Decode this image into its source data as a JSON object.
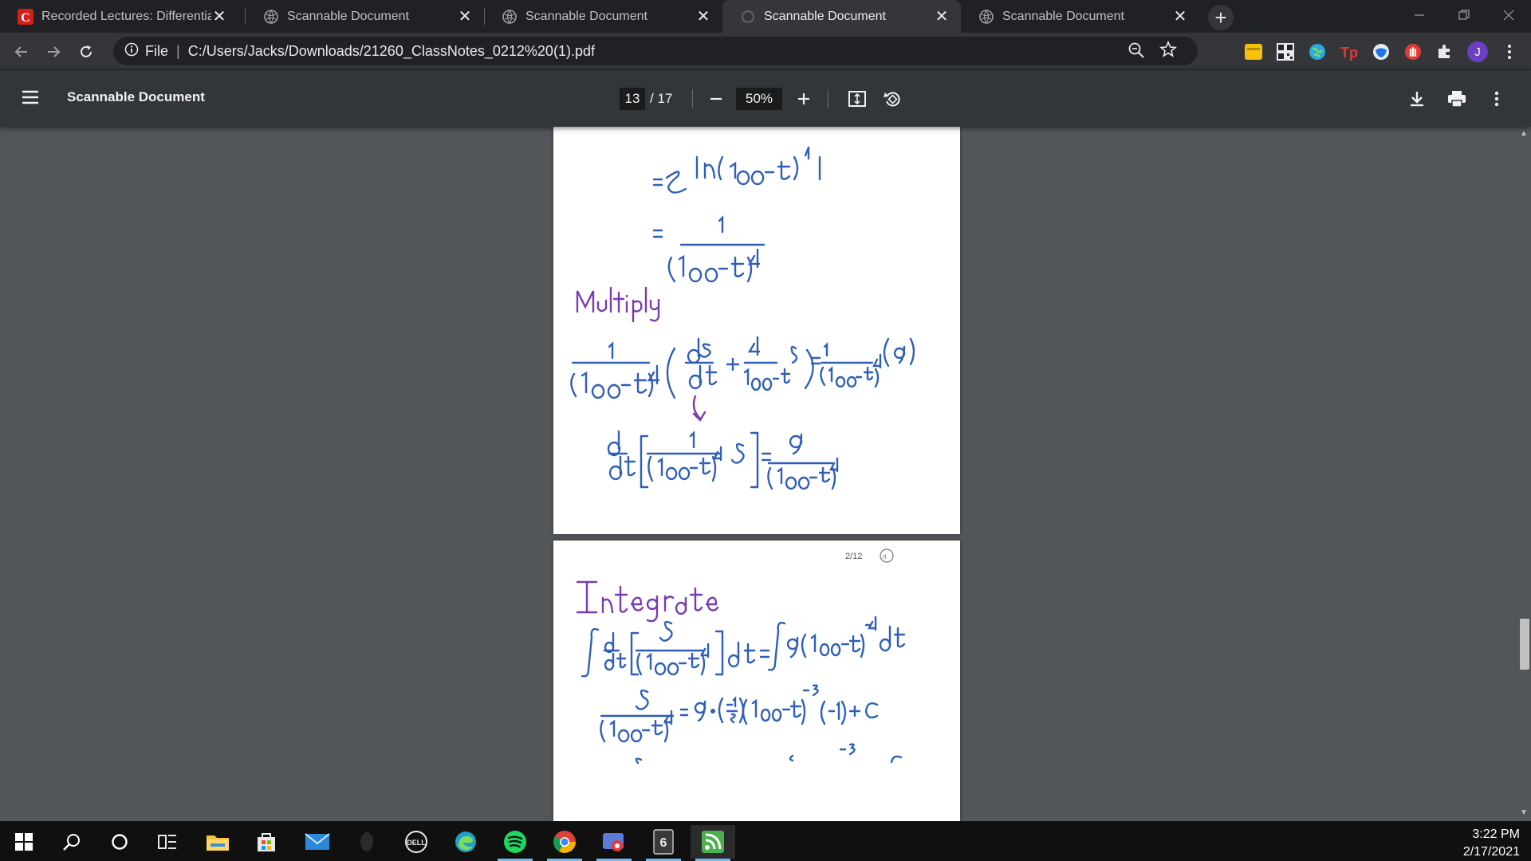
{
  "browser": {
    "tabs": [
      {
        "title": "Recorded Lectures: Differential Eq",
        "active": false,
        "favicon": "canvas-c-icon"
      },
      {
        "title": "Scannable Document",
        "active": false,
        "favicon": "globe-icon"
      },
      {
        "title": "Scannable Document",
        "active": false,
        "favicon": "globe-icon"
      },
      {
        "title": "Scannable Document",
        "active": true,
        "favicon": "loading-icon"
      },
      {
        "title": "Scannable Document",
        "active": false,
        "favicon": "globe-icon"
      }
    ],
    "close_glyph": "✕",
    "new_tab_glyph": "+",
    "address": {
      "scheme_label": "File",
      "separator": "|",
      "url": "C:/Users/Jacks/Downloads/21260_ClassNotes_0212%20(1).pdf"
    },
    "profile_initial": "J"
  },
  "pdf_viewer": {
    "title": "Scannable Document",
    "current_page": "13",
    "page_separator": "/ 17",
    "zoom": "50%"
  },
  "document": {
    "page1_heading": "Multiply",
    "page2_heading": "Integrate",
    "page2_header_note": "2/12"
  },
  "system": {
    "time": "3:22 PM",
    "date": "2/17/2021"
  },
  "colors": {
    "ink_blue": "#2f5fb8",
    "ink_purple": "#7a3bb0",
    "chrome_bg": "#202124",
    "pdf_toolbar": "#323639"
  }
}
